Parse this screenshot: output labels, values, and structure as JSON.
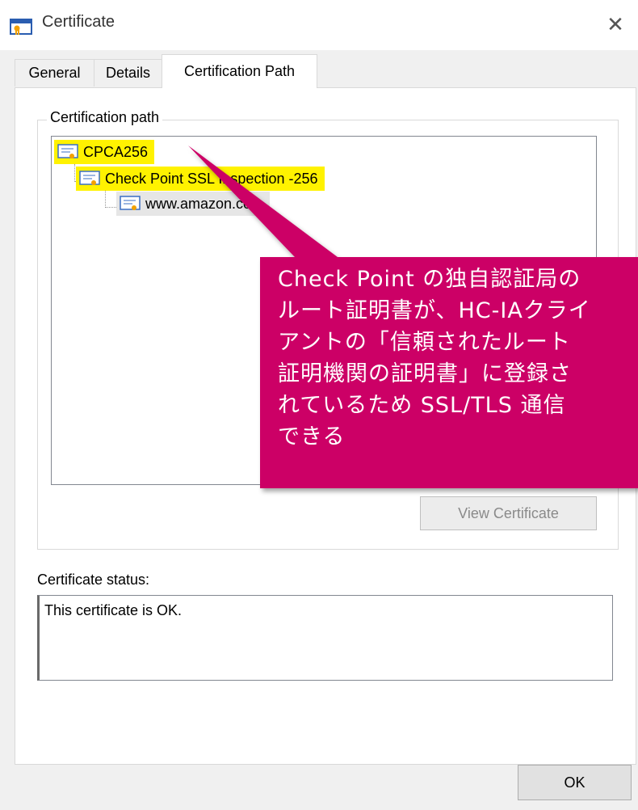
{
  "window": {
    "title": "Certificate",
    "close_glyph": "✕"
  },
  "tabs": [
    {
      "label": "General"
    },
    {
      "label": "Details"
    },
    {
      "label": "Certification Path"
    }
  ],
  "certification_path": {
    "legend": "Certification path",
    "items": [
      {
        "label": "CPCA256",
        "level": 0,
        "highlight": true
      },
      {
        "label": "Check Point SSL Inspection -256",
        "level": 1,
        "highlight": true
      },
      {
        "label": "www.amazon.com",
        "level": 2,
        "selected": true
      }
    ],
    "view_button": "View Certificate"
  },
  "status": {
    "label": "Certificate status:",
    "value": "This certificate is OK."
  },
  "ok_button": "OK",
  "annotation": {
    "text": "Check Point の独自認証局の\nルート証明書が、HC-IAクライ\nアントの「信頼されたルート\n証明機関の証明書」に登録さ\nれているため SSL/TLS 通信\nできる",
    "color": "#cc0066",
    "icon": "callout-pointer"
  },
  "colors": {
    "highlight": "#fff200",
    "accent": "#cc0066"
  }
}
